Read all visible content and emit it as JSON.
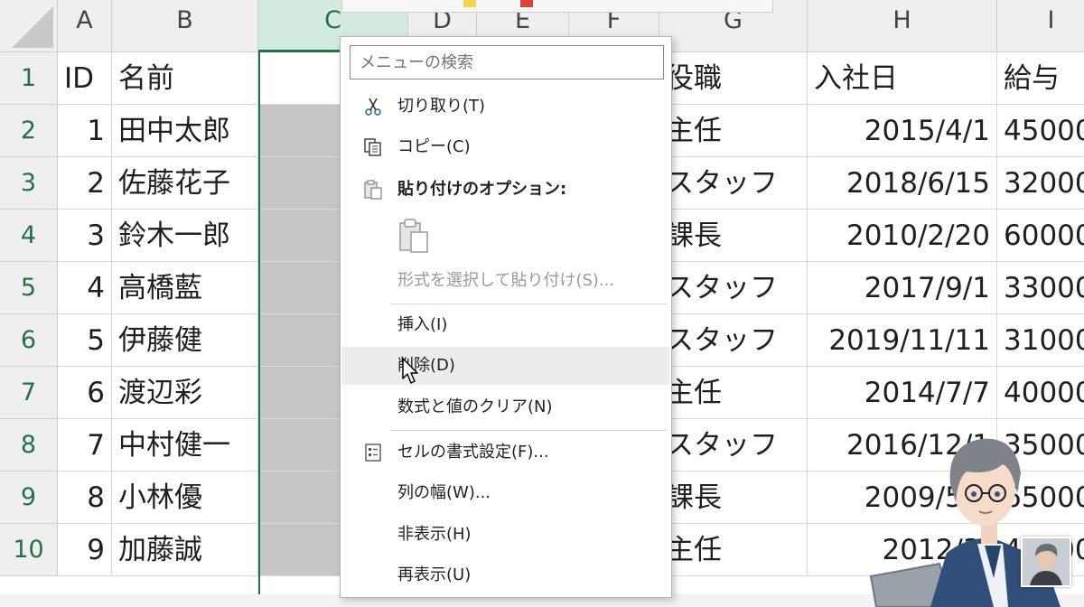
{
  "columns": [
    {
      "letter": "A",
      "selected": false
    },
    {
      "letter": "B",
      "selected": false
    },
    {
      "letter": "C",
      "selected": true
    },
    {
      "letter": "D",
      "selected": false
    },
    {
      "letter": "E",
      "selected": false
    },
    {
      "letter": "F",
      "selected": false
    },
    {
      "letter": "G",
      "selected": false
    },
    {
      "letter": "H",
      "selected": false
    },
    {
      "letter": "I",
      "selected": false
    }
  ],
  "row_numbers": [
    "1",
    "2",
    "3",
    "4",
    "5",
    "6",
    "7",
    "8",
    "9",
    "10"
  ],
  "header": {
    "a": "ID",
    "b": "名前",
    "g": "役職",
    "h": "入社日",
    "i": "給与"
  },
  "rows": [
    {
      "id": "1",
      "name": "田中太郎",
      "role": "主任",
      "date": "2015/4/1",
      "salary": "45000"
    },
    {
      "id": "2",
      "name": "佐藤花子",
      "role": "スタッフ",
      "date": "2018/6/15",
      "salary": "32000"
    },
    {
      "id": "3",
      "name": "鈴木一郎",
      "role": "課長",
      "date": "2010/2/20",
      "salary": "60000"
    },
    {
      "id": "4",
      "name": "高橋藍",
      "role": "スタッフ",
      "date": "2017/9/1",
      "salary": "33000"
    },
    {
      "id": "5",
      "name": "伊藤健",
      "role": "スタッフ",
      "date": "2019/11/11",
      "salary": "31000"
    },
    {
      "id": "6",
      "name": "渡辺彩",
      "role": "主任",
      "date": "2014/7/7",
      "salary": "40000"
    },
    {
      "id": "7",
      "name": "中村健一",
      "role": "スタッフ",
      "date": "2016/12/1",
      "salary": "35000"
    },
    {
      "id": "8",
      "name": "小林優",
      "role": "課長",
      "date": "2009/5/2",
      "salary": "65000"
    },
    {
      "id": "9",
      "name": "加藤誠",
      "role": "主任",
      "date": "2012/3/",
      "salary": "45000"
    }
  ],
  "context_menu": {
    "search_placeholder": "メニューの検索",
    "items": [
      {
        "label": "切り取り(T)",
        "icon": "scissors-icon"
      },
      {
        "label": "コピー(C)",
        "icon": "copy-icon"
      },
      {
        "label": "貼り付けのオプション:",
        "icon": "paste-options-icon"
      },
      {
        "label": "形式を選択して貼り付け(S)...",
        "state": "disabled"
      },
      {
        "label": "挿入(I)"
      },
      {
        "label": "削除(D)",
        "state": "hover"
      },
      {
        "label": "数式と値のクリア(N)"
      },
      {
        "label": "セルの書式設定(F)...",
        "icon": "format-cells-icon"
      },
      {
        "label": "列の幅(W)..."
      },
      {
        "label": "非表示(H)"
      },
      {
        "label": "再表示(U)"
      }
    ]
  },
  "colors": {
    "accent": "#217346",
    "selected_header_bg": "#d3ebde",
    "selected_column_bg": "#c6c6c6",
    "menu_hover_bg": "#ececec"
  }
}
